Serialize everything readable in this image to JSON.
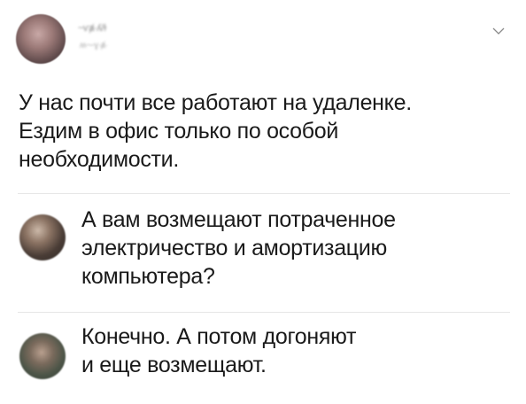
{
  "post": {
    "author": {
      "name": "~ѵⱥ·ʎ/ɫ",
      "handle": "ʍ⁓ɣ·ⱥ·"
    },
    "text_lines": [
      "У нас почти все работают на удаленке.",
      "Ездим в офис только по особой",
      "необходимости."
    ]
  },
  "comments": [
    {
      "text_lines": [
        "А вам возмещают потраченное",
        "электричество и амортизацию",
        "компьютера?"
      ]
    },
    {
      "text_lines": [
        "Конечно. А потом догоняют",
        "и еще возмещают."
      ]
    }
  ],
  "icons": {
    "options": "chevron-down-icon"
  },
  "colors": {
    "text": "#1a1a1a",
    "divider": "#e6e6e6",
    "muted": "#8a8a8a"
  }
}
